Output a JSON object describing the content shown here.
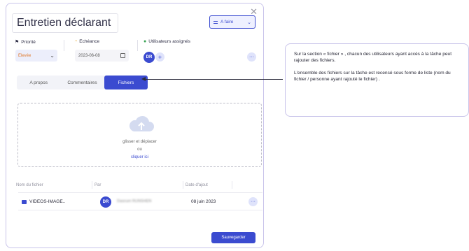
{
  "modal": {
    "title": "Entretien déclarant",
    "status": "A faire",
    "close": "✕",
    "priority_label": "Priorité",
    "priority_value": "Elevée",
    "due_label": "Echéance",
    "due_value": "2023-06-08",
    "users_label": "Utilisateurs assignés",
    "avatar_initials": "DR",
    "add_user": "+",
    "more": "···",
    "tabs": [
      "A propos",
      "Commentaires",
      "Fichiers"
    ],
    "dropzone": {
      "drag_text": "glisser et déplacer",
      "or_text": "ou",
      "click_text": "cliquer ici"
    },
    "table": {
      "headers": [
        "Nom du fichier",
        "Par",
        "Date d'ajout"
      ],
      "rows": [
        {
          "file": "VIDEOS-IMAGE..",
          "by_initials": "DR",
          "by_name": "Dasnum RUNSHEN",
          "date": "08 juin 2023"
        }
      ]
    },
    "save_label": "Sauvegarder"
  },
  "callout": {
    "para1": "Sur la section « fichier » , chacun des utilisateurs ayant accès à la tâche peut rajouter des fichiers.",
    "para2": "L'ensemble des fichiers sur la tâche est recensé sous forme de liste (nom du fichier / personne ayant rajouté le fichier) ."
  },
  "colors": {
    "accent": "#3b4bd0",
    "priority": "#e07a2e",
    "users_icon": "#3aa455",
    "due_icon": "#e6a21a"
  }
}
